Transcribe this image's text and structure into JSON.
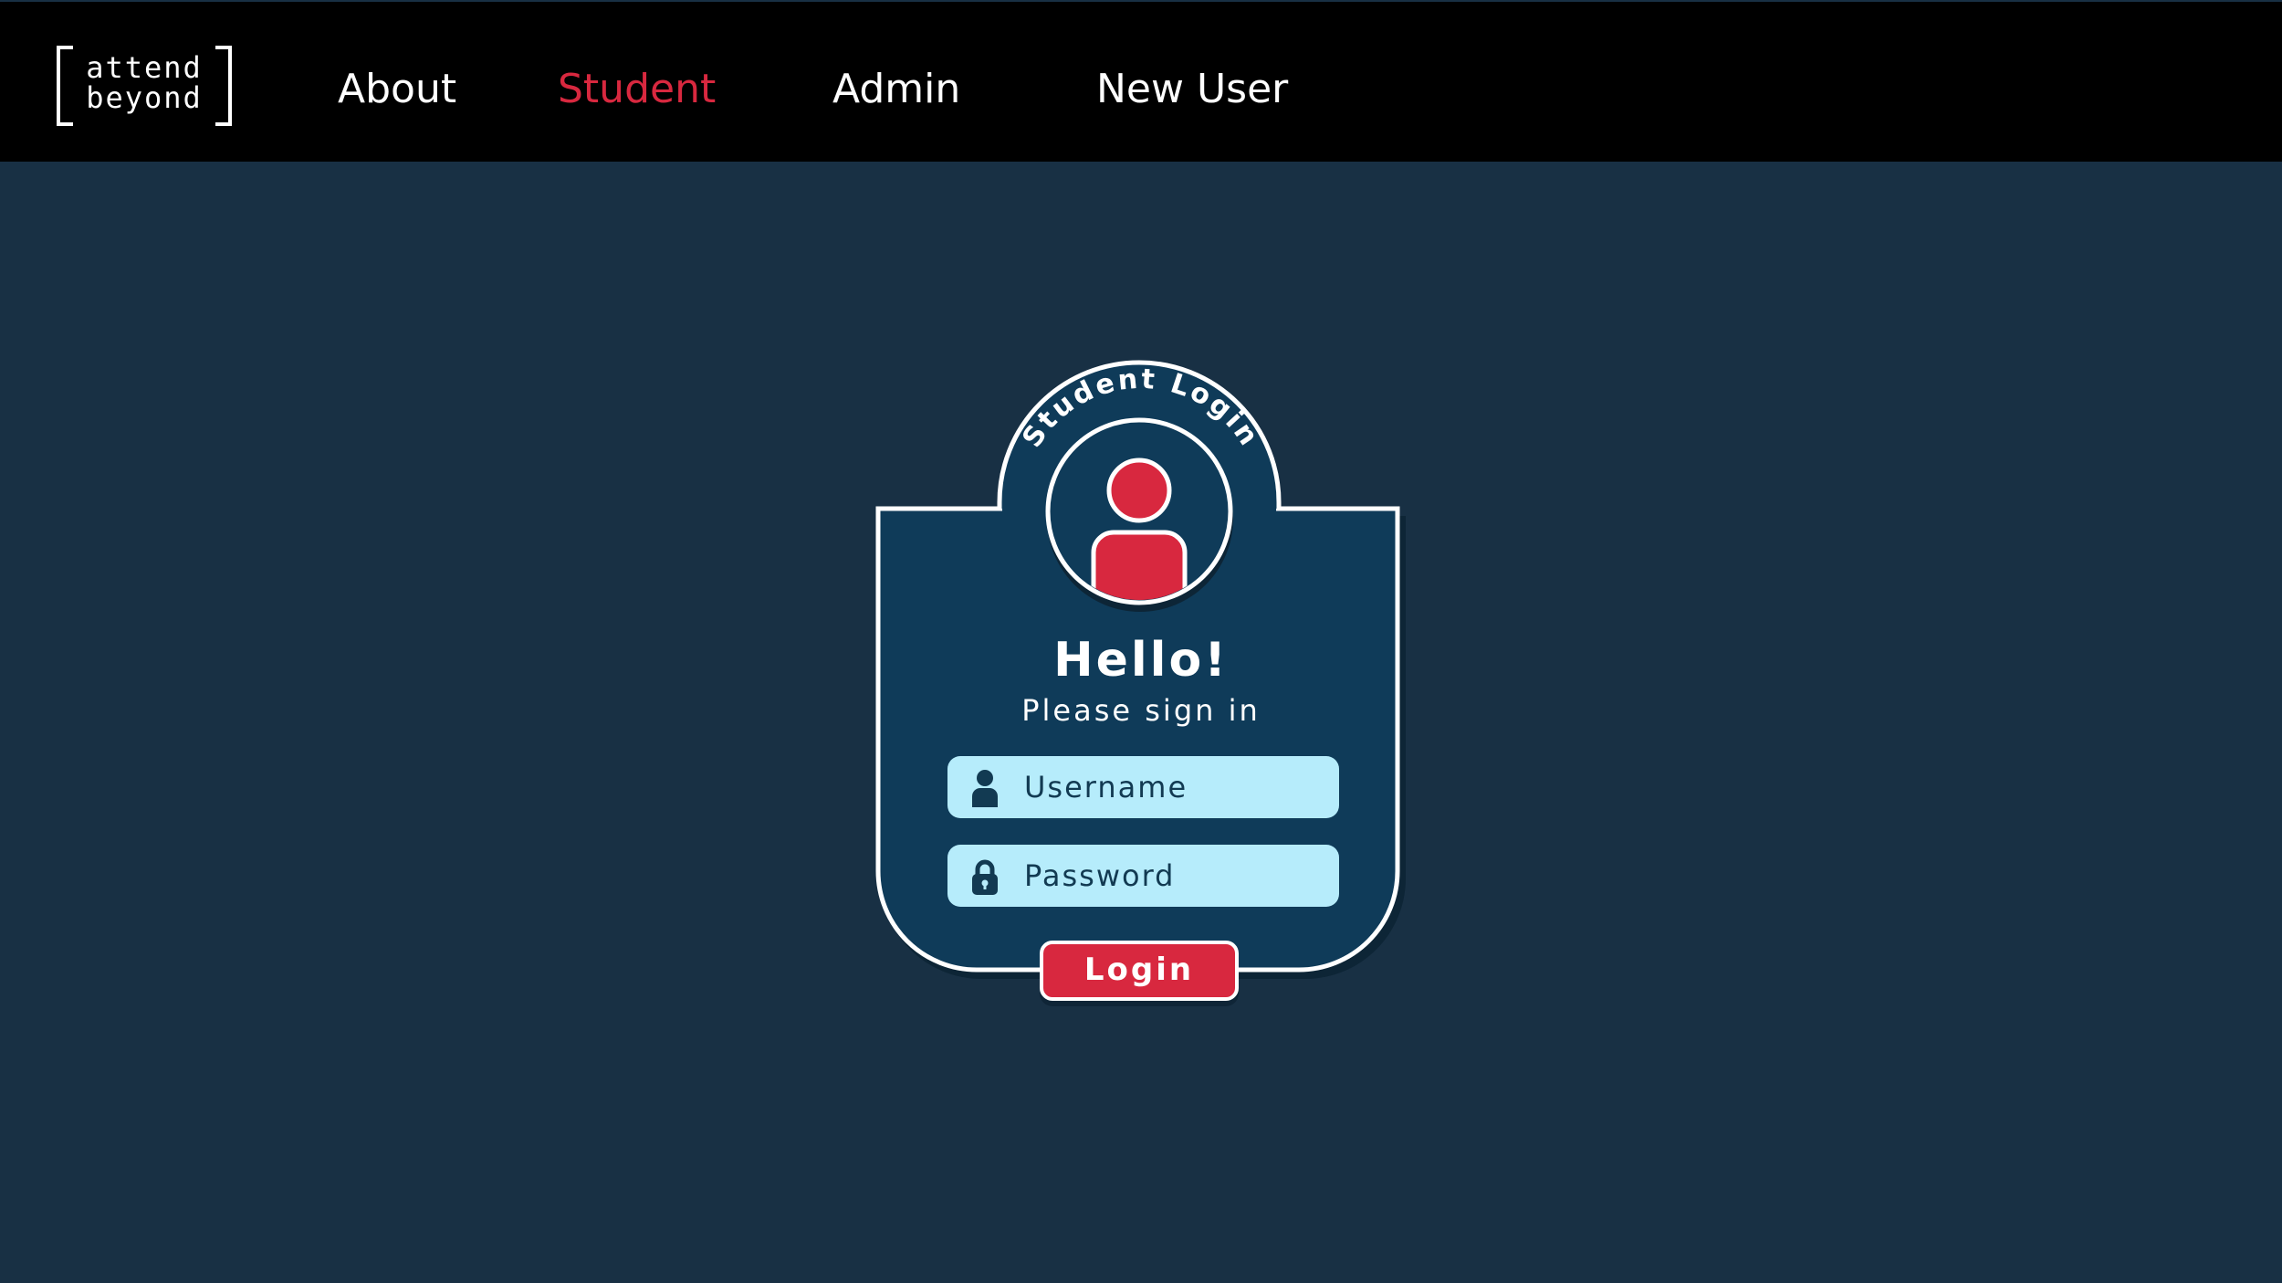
{
  "logo": {
    "line1": "attend",
    "line2": "beyond"
  },
  "nav": {
    "about": "About",
    "student": "Student",
    "admin": "Admin",
    "new_user": "New User",
    "active": "Student"
  },
  "card": {
    "badge_text": "Student Login",
    "title": "Hello!",
    "subtitle": "Please sign in",
    "username_placeholder": "Username",
    "password_placeholder": "Password",
    "login_label": "Login",
    "avatar_icon": "user-avatar-icon",
    "username_icon": "user-icon",
    "password_icon": "lock-icon"
  },
  "colors": {
    "background": "#183044",
    "topbar": "#000000",
    "card": "#0f3b59",
    "accent": "#d8283f",
    "field": "#b6ecfb",
    "field_text": "#123a52",
    "white": "#ffffff"
  }
}
